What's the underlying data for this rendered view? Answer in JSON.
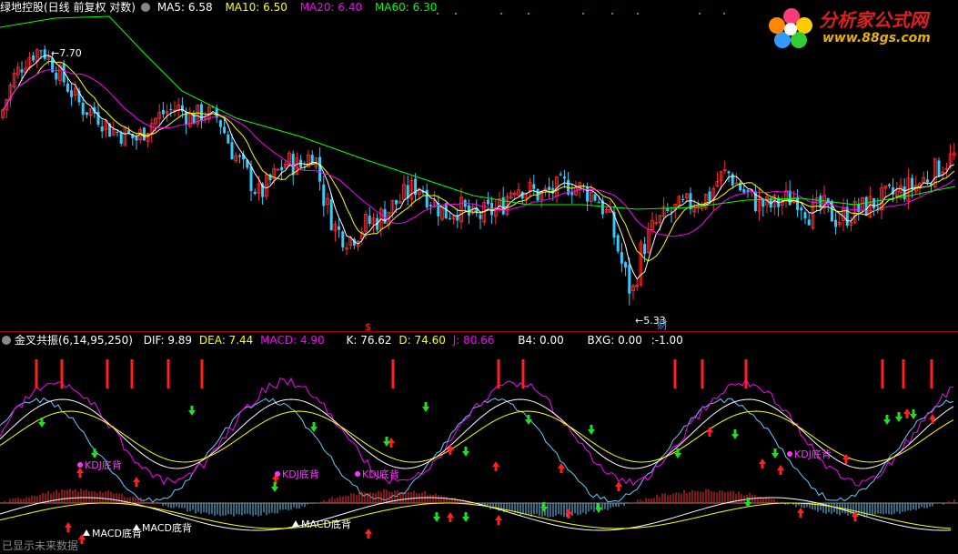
{
  "top": {
    "title": "绿地控股(日线 前复权 对数)",
    "ma": [
      {
        "label": "MA5: 6.58",
        "color": "#ffffff"
      },
      {
        "label": "MA10: 6.50",
        "color": "#ffff00"
      },
      {
        "label": "MA20: 6.40",
        "color": "#ff00ff"
      },
      {
        "label": "MA60: 6.30",
        "color": "#00ff00"
      }
    ],
    "high_label": "7.70",
    "low_label": "5.33",
    "cai_label": "财",
    "s_label": "$"
  },
  "bottom": {
    "title": "金叉共振(6,14,95,250)",
    "items": [
      {
        "label": "DIF: 9.89",
        "color": "#ffffff"
      },
      {
        "label": "DEA: 7.44",
        "color": "#ffff00"
      },
      {
        "label": "MACD: 4.90",
        "color": "#ff00ff"
      },
      {
        "label": "K: 76.62",
        "color": "#ffffff"
      },
      {
        "label": "D: 74.60",
        "color": "#ffff00"
      },
      {
        "label": "J: 80.66",
        "color": "#ff00ff"
      },
      {
        "label": "B4: 0.00",
        "color": "#ffffff"
      },
      {
        "label": "BXG: 0.00",
        "color": "#ffffff"
      },
      {
        "label": ":-1.00",
        "color": "#ffffff"
      }
    ],
    "kdj_label": "KDJ底背",
    "macd_label": "MACD底背",
    "footer": "已显示未来数据"
  },
  "logo": {
    "name": "分析家公式网",
    "url": "www.88gs.com"
  },
  "chart_data": {
    "type": "candlestick",
    "title": "绿地控股(日线 前复权 对数)",
    "y_scale": "log",
    "ylim": [
      5.2,
      7.9
    ],
    "annotated_high": 7.7,
    "annotated_low": 5.33,
    "ma_values": {
      "MA5": 6.58,
      "MA10": 6.5,
      "MA20": 6.4,
      "MA60": 6.3
    },
    "indicator": {
      "DIF": 9.89,
      "DEA": 7.44,
      "MACD": 4.9,
      "K": 76.62,
      "D": 74.6,
      "J": 80.66,
      "B4": 0.0,
      "BXG": 0.0,
      "extra": -1.0
    }
  },
  "colors": {
    "up": "#ff3030",
    "down": "#33ccff",
    "ma5": "#ffffff",
    "ma10": "#ffff00",
    "ma20": "#ff00ff",
    "ma60": "#00ff00"
  }
}
